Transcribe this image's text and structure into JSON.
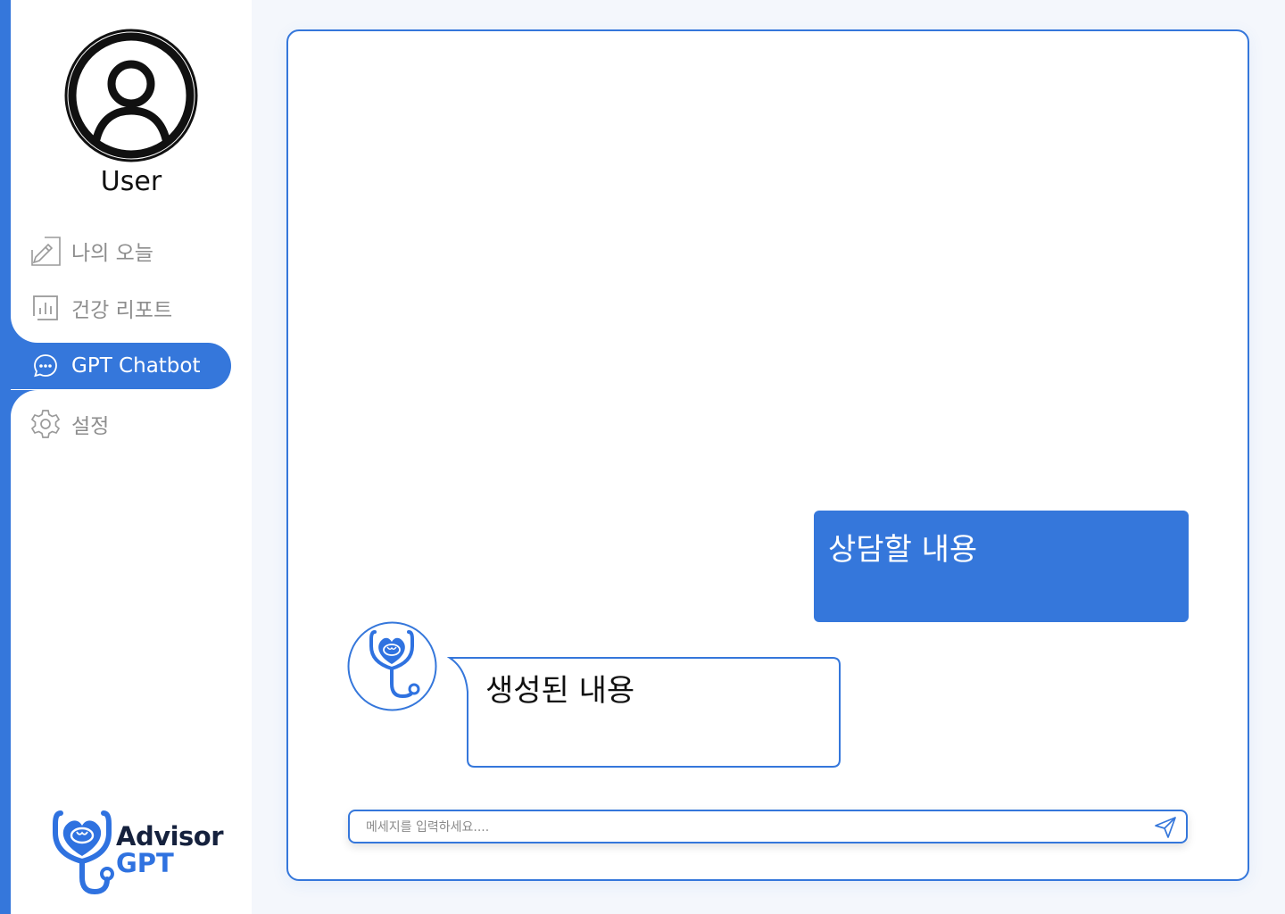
{
  "user": {
    "name": "User"
  },
  "nav": {
    "items": [
      {
        "label": "나의 오늘",
        "icon": "edit-icon"
      },
      {
        "label": "건강 리포트",
        "icon": "chart-icon"
      },
      {
        "label": "GPT Chatbot",
        "icon": "chat-icon",
        "active": true
      },
      {
        "label": "설정",
        "icon": "gear-icon"
      }
    ]
  },
  "brand": {
    "line1": "Advisor",
    "line2": "GPT"
  },
  "chat": {
    "user_message": "상담할 내용",
    "bot_message": "생성된 내용"
  },
  "input": {
    "placeholder": "메세지를 입력하세요....",
    "value": ""
  },
  "colors": {
    "accent": "#3577db",
    "text_muted": "#8d8d8d",
    "brand_dark": "#15213d"
  }
}
